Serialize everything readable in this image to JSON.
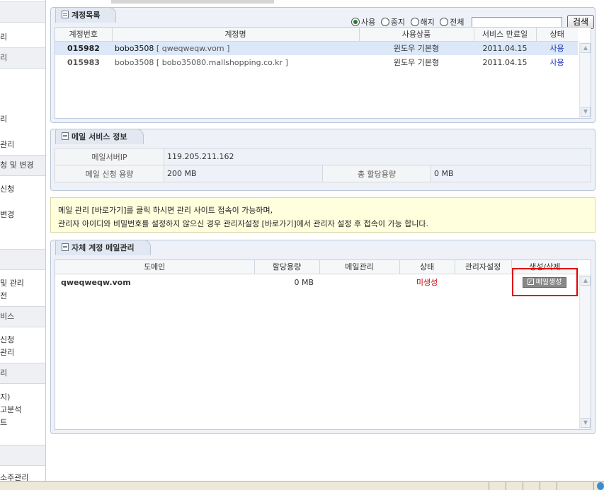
{
  "sidebar": {
    "items": [
      {
        "label": "리"
      },
      {
        "label": "리",
        "header": true
      },
      {
        "label": "리"
      },
      {
        "label": "관리"
      },
      {
        "label": "청 및 변경",
        "header": true
      },
      {
        "label": "신청"
      },
      {
        "label": "변경"
      },
      {
        "label": "",
        "header": true
      },
      {
        "label": "및 관리"
      },
      {
        "label": "전"
      },
      {
        "label": "비스",
        "header": true
      },
      {
        "label": "신청"
      },
      {
        "label": "관리"
      },
      {
        "label": "리",
        "header": true
      },
      {
        "label": "지)"
      },
      {
        "label": "고분석"
      },
      {
        "label": "트"
      },
      {
        "label": "",
        "header": true
      },
      {
        "label": "소주관리"
      }
    ]
  },
  "accounts": {
    "tab_title": "계정목록",
    "filters": [
      {
        "label": "사용",
        "selected": true
      },
      {
        "label": "중지",
        "selected": false
      },
      {
        "label": "해지",
        "selected": false
      },
      {
        "label": "전체",
        "selected": false
      }
    ],
    "search_value": "",
    "search_button": "검색",
    "columns": [
      "계정번호",
      "계정명",
      "사용상품",
      "서비스 만료일",
      "상태"
    ],
    "rows": [
      {
        "id": "015982",
        "name_user": "bobo3508",
        "name_domain": "[ qweqweqw.vom ]",
        "product": "윈도우 기본형",
        "expiry": "2011.04.15",
        "status": "사용"
      },
      {
        "id": "015983",
        "name_user": "bobo3508",
        "name_domain": "[ bobo35080.mallshopping.co.kr ]",
        "product": "윈도우 기본형",
        "expiry": "2011.04.15",
        "status": "사용"
      }
    ]
  },
  "mail_info": {
    "tab_title": "메일 서비스 정보",
    "server_label": "메일서버IP",
    "server_value": "119.205.211.162",
    "capacity_label": "메일 신청 용량",
    "capacity_value": "200 MB",
    "allocated_label": "총 할당용량",
    "allocated_value": "0 MB"
  },
  "notice": {
    "line1": "메일 관리 [바로가기]를 클릭 하시면 관리 사이트 접속이 가능하며,",
    "line2": "관리자 아이디와 비밀번호를 설정하지 않으신 경우 관리자설정 [바로가기]에서 관리자 설정 후 접속이 가능 합니다."
  },
  "self_mail": {
    "tab_title": "자체 계정 메일관리",
    "columns": [
      "도메인",
      "할당용량",
      "메일관리",
      "상태",
      "관리자설정",
      "생성/삭제"
    ],
    "rows": [
      {
        "domain": "qweqweqw.vom",
        "capacity": "0 MB",
        "mail_manage": "",
        "status": "미생성",
        "admin": "",
        "action": "메일생성"
      }
    ]
  },
  "colors": {
    "panel_border": "#b9c6d8",
    "status_link": "#1a33b8",
    "status_uncreated": "#cc0000",
    "highlight_frame": "#e00000",
    "selected_row": "#dce8f8"
  }
}
